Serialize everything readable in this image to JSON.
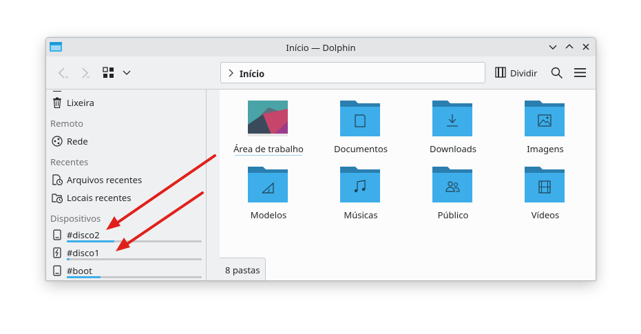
{
  "window": {
    "title": "Início — Dolphin"
  },
  "toolbar": {
    "view_mode_label": "",
    "split_label": "Dividir"
  },
  "location": {
    "crumb": "Início"
  },
  "sidebar": {
    "trash": "Lixeira",
    "remote_header": "Remoto",
    "network": "Rede",
    "recent_header": "Recentes",
    "recent_files": "Arquivos recentes",
    "recent_locations": "Locais recentes",
    "devices_header": "Dispositivos",
    "devices": [
      {
        "label": "#disco2",
        "usage": 0.35
      },
      {
        "label": "#disco1",
        "usage": 0.02
      },
      {
        "label": "#boot",
        "usage": 0.25
      }
    ]
  },
  "items": [
    {
      "label": "Área de trabalho",
      "icon": "desktop-thumbnail"
    },
    {
      "label": "Documentos",
      "icon": "folder-documents-icon"
    },
    {
      "label": "Downloads",
      "icon": "folder-downloads-icon"
    },
    {
      "label": "Imagens",
      "icon": "folder-pictures-icon"
    },
    {
      "label": "Modelos",
      "icon": "folder-templates-icon"
    },
    {
      "label": "Músicas",
      "icon": "folder-music-icon"
    },
    {
      "label": "Público",
      "icon": "folder-public-icon"
    },
    {
      "label": "Vídeos",
      "icon": "folder-videos-icon"
    }
  ],
  "status": {
    "text": "8 pastas"
  },
  "colors": {
    "folder": "#3daee9",
    "folder_tab": "#2a7fb0",
    "accent": "#3daee9",
    "annotation": "#e0201b"
  }
}
